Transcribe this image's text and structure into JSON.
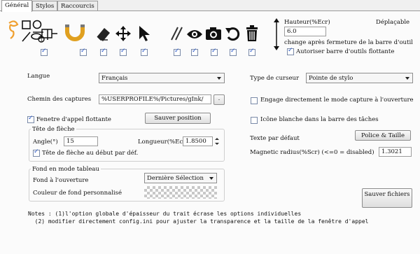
{
  "tabs": [
    "Général",
    "Stylos",
    "Raccourcis"
  ],
  "toolbar_checks": [
    true,
    true,
    true,
    true,
    true,
    true,
    true,
    true,
    true,
    true
  ],
  "height_section": {
    "label": "Hauteur(%Ecr)",
    "value": "6.0",
    "movable_label": "Déplaçable",
    "change_label": "change après fermeture de la barre d'outil",
    "floating_label": "Autoriser barre d'outils flottante",
    "floating_checked": true
  },
  "language": {
    "label": "Langue",
    "value": "Français"
  },
  "capture_path": {
    "label": "Chemin des captures",
    "value": "%USERPROFILE%/Pictures/gInk/",
    "browse": "."
  },
  "callout": {
    "window_label": "Fenetre d'appel flottante",
    "window_checked": true,
    "save_position": "Sauver position"
  },
  "arrowhead": {
    "title": "Tête de flèche",
    "angle_label": "Angle(°)",
    "angle_value": "15",
    "length_label": "Longueur(%Ecr)",
    "length_value": "1.8500",
    "start_label": "Tête de flèche au début par déf.",
    "start_checked": true
  },
  "board": {
    "title": "Fond en mode tableau",
    "open_label": "Fond à l'ouverture",
    "open_value": "Dernière Sélection",
    "custom_label": "Couleur de fond personnalisé"
  },
  "cursor": {
    "label": "Type de curseur",
    "value": "Pointe de stylo"
  },
  "direct_capture": {
    "label": "Engage directement le mode capture à l'ouverture",
    "checked": false
  },
  "white_icon": {
    "label": "Icône blanche dans la barre des tâches",
    "checked": false
  },
  "default_text": {
    "label": "Texte par défaut",
    "button": "Police & Taille"
  },
  "magnetic": {
    "label": "Magnetic radius(%Scr) (<=0 = disabled)",
    "value": "1.3021"
  },
  "save_button": "Sauver fichiers",
  "notes": [
    "Notes : (1)l'option globale d'épaisseur du trait écrase les options individuelles",
    "  (2) modifier directement config.ini pour ajuster la transparence et la taille de la fenêtre d'appel"
  ]
}
